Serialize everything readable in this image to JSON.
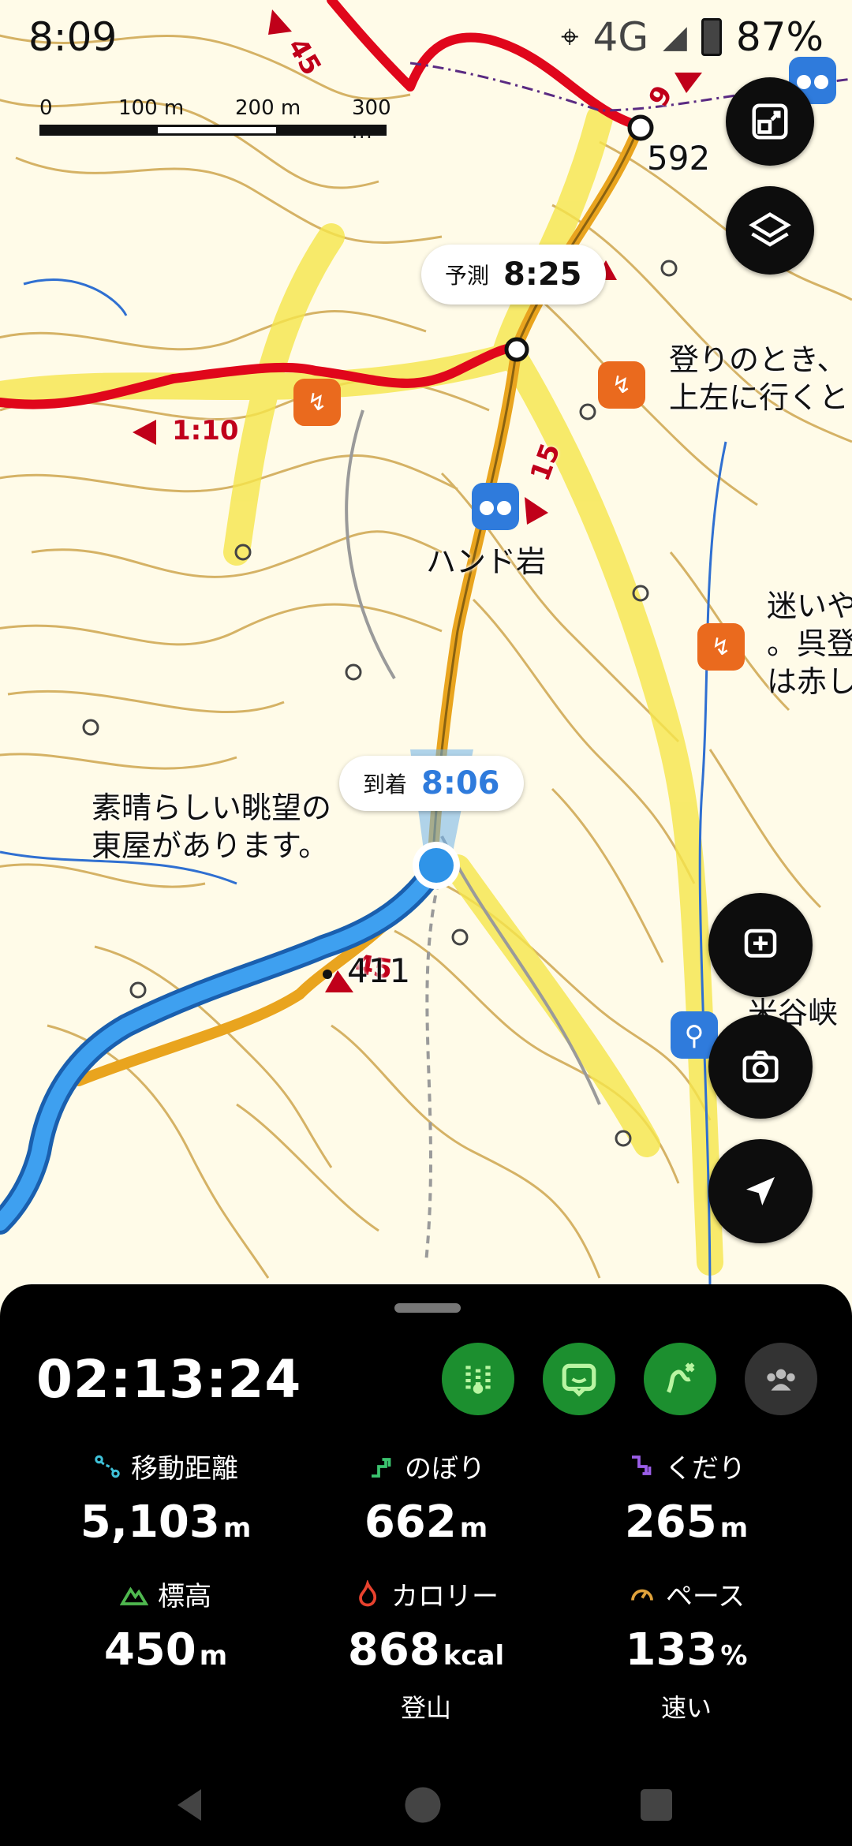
{
  "status_bar": {
    "time": "8:09",
    "network": "4G",
    "battery": "87%"
  },
  "scale_bar": {
    "labels": [
      "0",
      "100 m",
      "200 m",
      "300 m"
    ]
  },
  "map": {
    "forecast_bubble": {
      "label": "予測",
      "time": "8:25"
    },
    "arrival_bubble": {
      "label": "到着",
      "time": "8:06"
    },
    "elevation_592": "592",
    "elevation_411": "411",
    "labels": {
      "hand_rock": "ハンド岩",
      "view_note": "素晴らしい眺望の\n東屋があります。",
      "climb_note": "登りのとき、\n上左に行くと",
      "lost_note": "迷いや\n。呉登\nは赤し",
      "gorge": "米谷峡\n。"
    },
    "course_times": {
      "t45_top": "45",
      "t9": "9",
      "t110": "1:10",
      "t15": "15",
      "t45_bottom": "45"
    }
  },
  "panel": {
    "elapsed": "02:13:24",
    "stats": [
      {
        "label": "移動距離",
        "value": "5,103",
        "unit": "m",
        "sub": ""
      },
      {
        "label": "のぼり",
        "value": "662",
        "unit": "m",
        "sub": ""
      },
      {
        "label": "くだり",
        "value": "265",
        "unit": "m",
        "sub": ""
      },
      {
        "label": "標高",
        "value": "450",
        "unit": "m",
        "sub": ""
      },
      {
        "label": "カロリー",
        "value": "868",
        "unit": "kcal",
        "sub": "登山"
      },
      {
        "label": "ペース",
        "value": "133",
        "unit": "%",
        "sub": "速い"
      }
    ]
  },
  "colors": {
    "route_red": "#e0061b",
    "trail_orange": "#e9a41e",
    "track_blue": "#2f94e8",
    "contour": "#c79a3a",
    "highlight_yellow": "#f6e64b",
    "tool_green": "#1c8f2f"
  }
}
